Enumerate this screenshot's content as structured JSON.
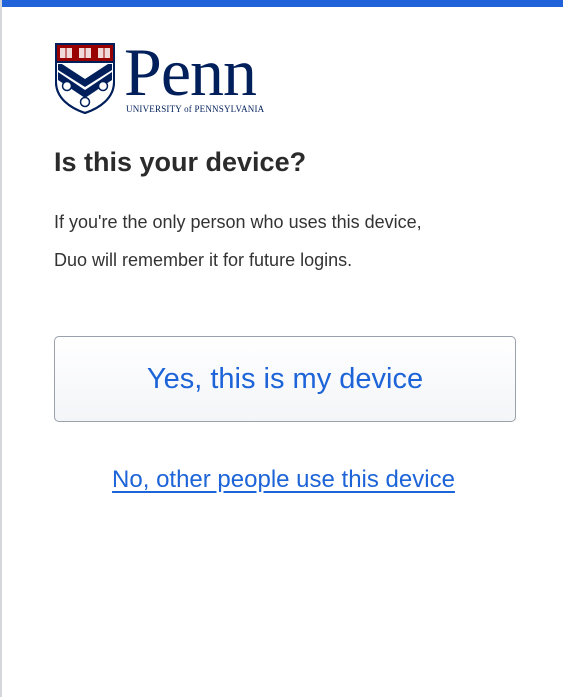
{
  "colors": {
    "accent": "#1f62d9",
    "link": "#1d64d8",
    "brand_navy": "#011f5b",
    "brand_red": "#990000"
  },
  "logo": {
    "wordmark": "Penn",
    "subtitle": "UNIVERSITY of PENNSYLVANIA",
    "icon": "penn-shield-icon"
  },
  "prompt": {
    "title": "Is this your device?",
    "description_line1": "If you're the only person who uses this device,",
    "description_line2": "Duo will remember it for future logins."
  },
  "actions": {
    "yes_label": "Yes, this is my device",
    "no_label": "No, other people use this device"
  }
}
